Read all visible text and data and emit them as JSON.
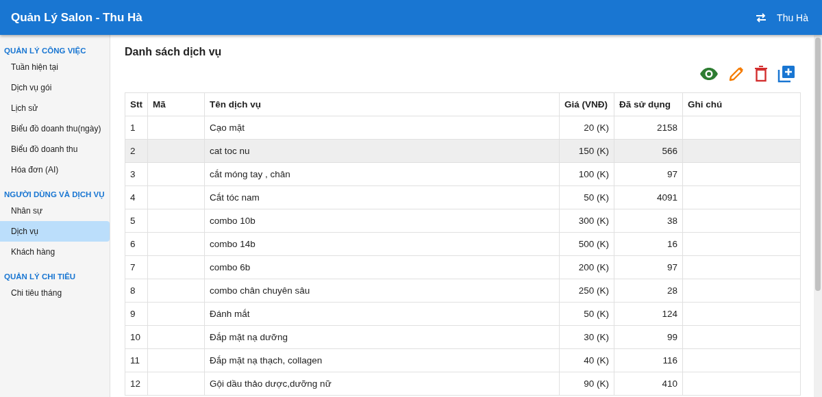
{
  "app_bar": {
    "title": "Quản Lý Salon - Thu Hà",
    "user": "Thu Hà"
  },
  "sidebar": {
    "sections": [
      {
        "heading": "QUẢN LÝ CÔNG VIỆC",
        "items": [
          {
            "label": "Tuần hiện tại",
            "selected": false
          },
          {
            "label": "Dịch vụ gói",
            "selected": false
          },
          {
            "label": "Lịch sử",
            "selected": false
          },
          {
            "label": "Biểu đồ doanh thu(ngày)",
            "selected": false
          },
          {
            "label": "Biểu đồ doanh thu",
            "selected": false
          },
          {
            "label": "Hóa đơn (AI)",
            "selected": false
          }
        ]
      },
      {
        "heading": "NGƯỜI DÙNG VÀ DỊCH VỤ",
        "items": [
          {
            "label": "Nhân sự",
            "selected": false
          },
          {
            "label": "Dịch vụ",
            "selected": true
          },
          {
            "label": "Khách hàng",
            "selected": false
          }
        ]
      },
      {
        "heading": "QUẢN LÝ CHI TIÊU",
        "items": [
          {
            "label": "Chi tiêu tháng",
            "selected": false
          }
        ]
      }
    ]
  },
  "page_title": "Danh sách dịch vụ",
  "toolbar": [
    {
      "kind": "view"
    },
    {
      "kind": "edit"
    },
    {
      "kind": "delete"
    },
    {
      "kind": "add"
    }
  ],
  "table": {
    "columns": [
      "Stt",
      "Mã",
      "Tên dịch vụ",
      "Giá (VNĐ)",
      "Đã sử dụng",
      "Ghi chú"
    ],
    "rows": [
      {
        "stt": "1",
        "name": "Cạo mặt",
        "price": "20 (K)",
        "used": "2158",
        "selected": false
      },
      {
        "stt": "2",
        "name": "cat toc nu",
        "price": "150 (K)",
        "used": "566",
        "selected": true
      },
      {
        "stt": "3",
        "name": "cắt móng tay , chân",
        "price": "100 (K)",
        "used": "97",
        "selected": false
      },
      {
        "stt": "4",
        "name": "Cắt tóc nam",
        "price": "50 (K)",
        "used": "4091",
        "selected": false
      },
      {
        "stt": "5",
        "name": "combo 10b",
        "price": "300 (K)",
        "used": "38",
        "selected": false
      },
      {
        "stt": "6",
        "name": "combo 14b",
        "price": "500 (K)",
        "used": "16",
        "selected": false
      },
      {
        "stt": "7",
        "name": "combo 6b",
        "price": "200 (K)",
        "used": "97",
        "selected": false
      },
      {
        "stt": "8",
        "name": "combo chân chuyên sâu",
        "price": "250 (K)",
        "used": "28",
        "selected": false
      },
      {
        "stt": "9",
        "name": "Đánh mắt",
        "price": "50 (K)",
        "used": "124",
        "selected": false
      },
      {
        "stt": "10",
        "name": "Đắp mặt nạ dưỡng",
        "price": "30 (K)",
        "used": "99",
        "selected": false
      },
      {
        "stt": "11",
        "name": "Đắp mặt nạ thạch, collagen",
        "price": "40 (K)",
        "used": "116",
        "selected": false
      },
      {
        "stt": "12",
        "name": "Gội dầu thảo dược,dưỡng nữ",
        "price": "90 (K)",
        "used": "410",
        "selected": false
      }
    ]
  }
}
